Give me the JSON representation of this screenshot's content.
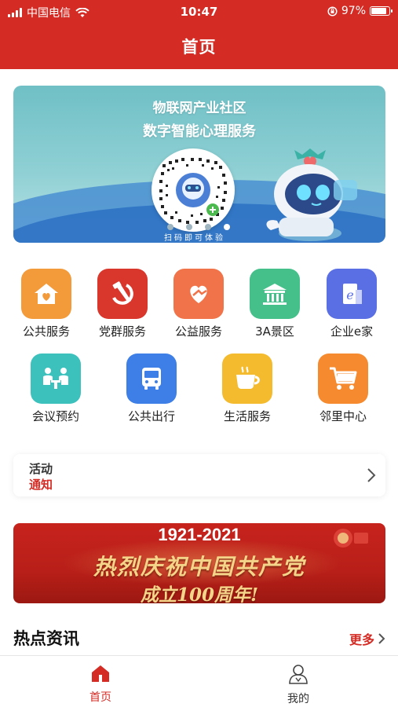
{
  "status_bar": {
    "carrier": "中国电信",
    "time": "10:47",
    "battery_text": "97%",
    "battery_level": 0.97
  },
  "header": {
    "title": "首页"
  },
  "hero": {
    "line1": "物联网产业社区",
    "line2": "数字智能心理服务",
    "qr_caption": "扫码即可体验",
    "slide_count": 4,
    "active_slide": 3
  },
  "services_row1": [
    {
      "label": "公共服务",
      "icon": "house-heart-icon",
      "color": "#f39a3a"
    },
    {
      "label": "党群服务",
      "icon": "hammer-sickle-icon",
      "color": "#d9362c"
    },
    {
      "label": "公益服务",
      "icon": "heart-hand-icon",
      "color": "#f07349"
    },
    {
      "label": "3A景区",
      "icon": "temple-icon",
      "color": "#45c08a"
    },
    {
      "label": "企业e家",
      "icon": "building-e-icon",
      "color": "#5b6fe5"
    }
  ],
  "services_row2": [
    {
      "label": "会议预约",
      "icon": "meeting-icon",
      "color": "#3dc1bd"
    },
    {
      "label": "公共出行",
      "icon": "bus-icon",
      "color": "#3d7fe6"
    },
    {
      "label": "生活服务",
      "icon": "coffee-cup-icon",
      "color": "#f5bb2e"
    },
    {
      "label": "邻里中心",
      "icon": "shopping-cart-icon",
      "color": "#f58a2f"
    }
  ],
  "notice": {
    "label_top": "活动",
    "label_bottom": "通知"
  },
  "banner": {
    "years": "1921-2021",
    "main_text": "热烈庆祝中国共产党",
    "sub_text": "成立100周年!"
  },
  "news": {
    "title": "热点资讯",
    "more": "更多"
  },
  "tabbar": {
    "items": [
      {
        "label": "首页",
        "icon": "home-icon",
        "active": true
      },
      {
        "label": "我的",
        "icon": "user-icon",
        "active": false
      }
    ],
    "active_color": "#d42c25",
    "inactive_color": "#333333"
  },
  "colors": {
    "brand_red": "#d42c25",
    "hero_teal": "#7ac6cb"
  }
}
